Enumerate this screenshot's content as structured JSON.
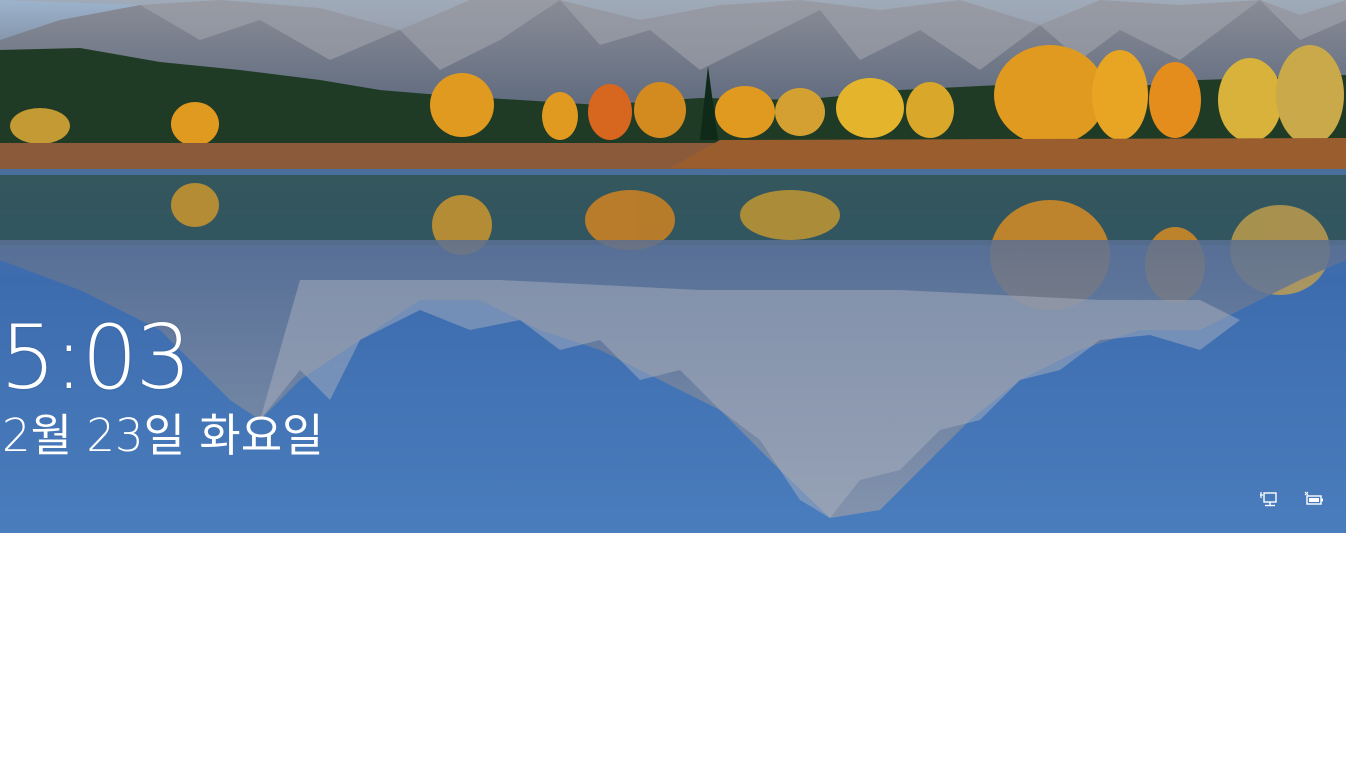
{
  "lock_screen": {
    "time": "5:03",
    "date": "2월 23일 화요일"
  },
  "status_icons": {
    "network": "network-icon",
    "battery": "battery-icon"
  },
  "colors": {
    "text": "#ffffff",
    "lake": "#3c6fb0",
    "autumn_trees": "#e09a20",
    "mountain": "#7d8594",
    "forest": "#1f3a25",
    "page_background": "#ffffff"
  }
}
